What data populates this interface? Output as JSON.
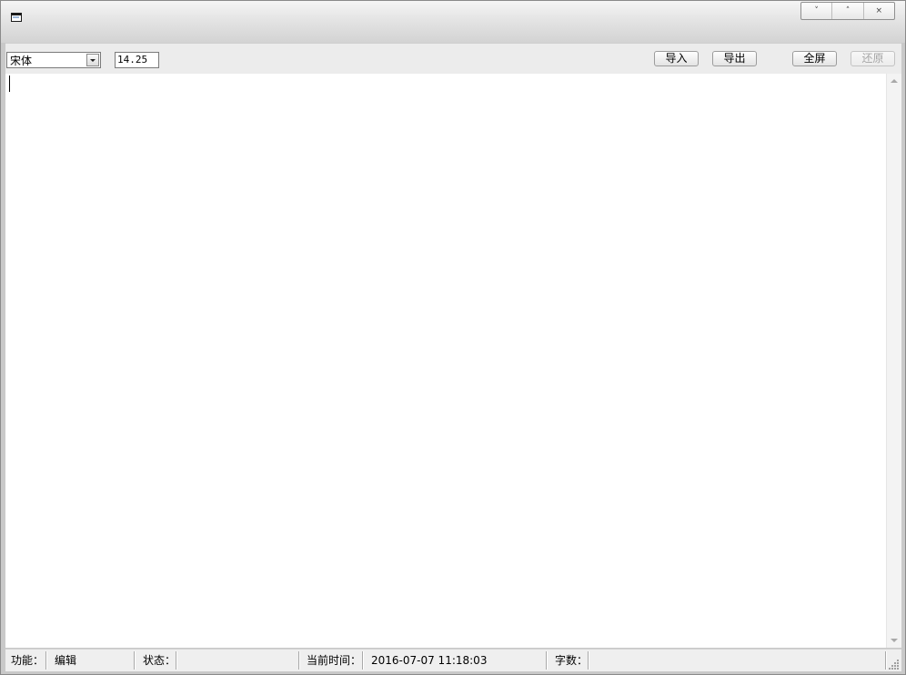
{
  "toolbar": {
    "font_name": "宋体",
    "font_size": "14.25",
    "import_label": "导入",
    "export_label": "导出",
    "fullscreen_label": "全屏",
    "restore_label": "还原"
  },
  "caption": {
    "minimize": "˅",
    "maximize": "˄",
    "close": "×"
  },
  "status": {
    "function_label": "功能：",
    "function_value": "编辑",
    "state_label": "状态：",
    "state_value": "",
    "time_label": "当前时间：",
    "time_value": "2016-07-07 11:18:03",
    "count_label": "字数：",
    "count_value": ""
  }
}
